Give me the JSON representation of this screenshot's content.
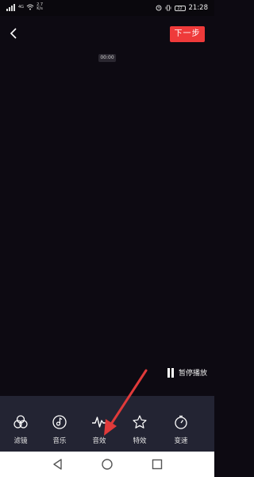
{
  "status_bar": {
    "signal_label": "4G",
    "speed_value": "2.7",
    "speed_unit": "K/s",
    "battery": "22",
    "time": "21:28"
  },
  "header": {
    "next_label": "下一步"
  },
  "player": {
    "timestamp": "00:00",
    "pause_label": "暂停播放"
  },
  "toolbar": {
    "items": [
      {
        "label": "滤镜",
        "icon": "filter-icon"
      },
      {
        "label": "音乐",
        "icon": "music-icon"
      },
      {
        "label": "音效",
        "icon": "sound-effect-icon"
      },
      {
        "label": "特效",
        "icon": "special-effect-icon"
      },
      {
        "label": "变速",
        "icon": "speed-icon"
      }
    ]
  },
  "nav_bar": {
    "icons": [
      "back-triangle-icon",
      "home-circle-icon",
      "recents-square-icon"
    ]
  },
  "colors": {
    "accent": "#ef3a3a",
    "toolbar_bg": "#232433",
    "canvas_bg": "#0d0a12",
    "annotation": "#e03a3a"
  }
}
